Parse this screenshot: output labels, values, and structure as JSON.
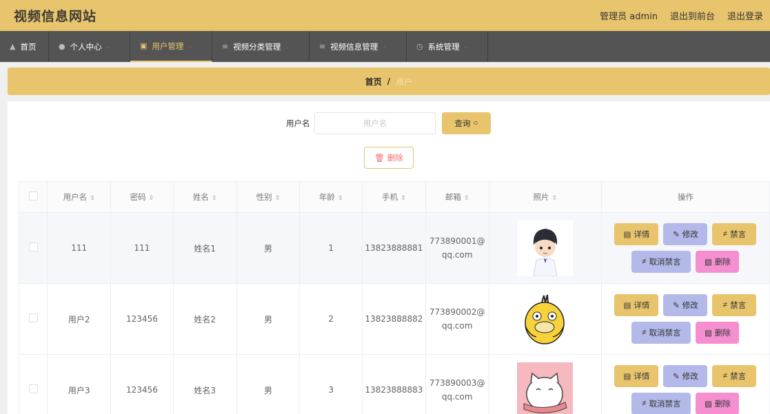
{
  "header": {
    "title": "视频信息网站",
    "admin_label": "管理员 admin",
    "to_front": "退出到前台",
    "logout": "退出登录"
  },
  "nav": [
    {
      "label": "首页",
      "icon": "home-icon"
    },
    {
      "label": "个人中心",
      "icon": "user-icon"
    },
    {
      "label": "用户管理",
      "icon": "card-icon",
      "active": true
    },
    {
      "label": "视频分类管理",
      "icon": "sliders-icon"
    },
    {
      "label": "视频信息管理",
      "icon": "list-icon"
    },
    {
      "label": "系统管理",
      "icon": "clock-icon"
    }
  ],
  "breadcrumb": {
    "home": "首页",
    "sep": "/",
    "current": "用户"
  },
  "search": {
    "label": "用户名",
    "placeholder": "用户名",
    "button": "查询"
  },
  "batch_delete": "删除",
  "table": {
    "headers": [
      "用户名",
      "密码",
      "姓名",
      "性别",
      "年龄",
      "手机",
      "邮箱",
      "照片",
      "操作"
    ],
    "rows": [
      {
        "username": "111",
        "password": "111",
        "name": "姓名1",
        "gender": "男",
        "age": "1",
        "phone": "13823888881",
        "email_a": "773890001@",
        "email_b": "qq.com"
      },
      {
        "username": "用户2",
        "password": "123456",
        "name": "姓名2",
        "gender": "男",
        "age": "2",
        "phone": "13823888882",
        "email_a": "773890002@",
        "email_b": "qq.com"
      },
      {
        "username": "用户3",
        "password": "123456",
        "name": "姓名3",
        "gender": "男",
        "age": "3",
        "phone": "13823888883",
        "email_a": "773890003@",
        "email_b": "qq.com"
      }
    ],
    "actions": {
      "detail": "详情",
      "edit": "修改",
      "mute": "禁言",
      "unmute": "取消禁言",
      "delete": "删除"
    }
  },
  "colors": {
    "accent": "#e8c56d",
    "nav_bg": "#545454",
    "edit": "#b3b9e8",
    "delete": "#f58fd0"
  }
}
